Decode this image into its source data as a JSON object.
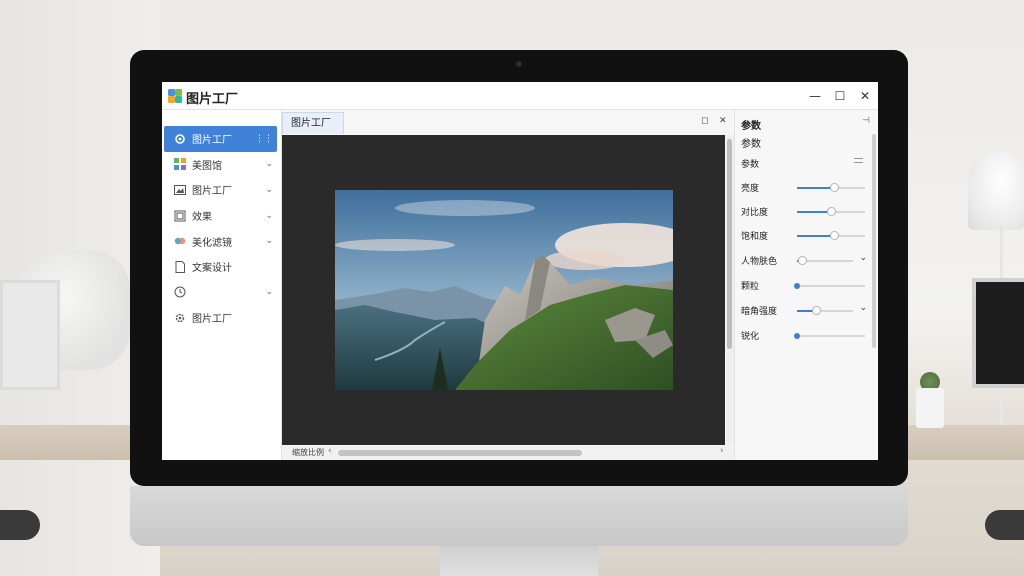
{
  "app": {
    "title": "图片工厂",
    "window_controls": {
      "minimize": "—",
      "maximize": "☐",
      "close": "✕"
    }
  },
  "sidebar": {
    "items": [
      {
        "label": "图片工厂",
        "icon": "gear-icon",
        "active": true
      },
      {
        "label": "美图馆",
        "icon": "grid-icon",
        "active": false
      },
      {
        "label": "图片工厂",
        "icon": "image-icon",
        "active": false
      },
      {
        "label": "效果",
        "icon": "frame-icon",
        "active": false
      },
      {
        "label": "美化滤镜",
        "icon": "filter-icon",
        "active": false
      },
      {
        "label": "文案设计",
        "icon": "document-icon",
        "active": false
      },
      {
        "label": "",
        "icon": "clock-icon",
        "active": false
      },
      {
        "label": "图片工厂",
        "icon": "settings-icon",
        "active": false
      }
    ]
  },
  "center": {
    "tab_label": "图片工厂",
    "tab_controls": {
      "restore": "◻",
      "close": "✕"
    },
    "zoom_label": "缩放比例",
    "scroll_left": "‹",
    "scroll_right": "›"
  },
  "panel": {
    "title": "参数",
    "subtitle": "参数",
    "group_label": "参数",
    "rows": [
      {
        "label": "亮度",
        "value": 0.55,
        "type": "slider"
      },
      {
        "label": "对比度",
        "value": 0.5,
        "type": "slider"
      },
      {
        "label": "饱和度",
        "value": 0.55,
        "type": "slider"
      },
      {
        "label": "人物肤色",
        "value": 0.1,
        "type": "slider-dropdown"
      },
      {
        "label": "颗粒",
        "value": 0.0,
        "type": "dot"
      },
      {
        "label": "暗角强度",
        "value": 0.35,
        "type": "slider-dropdown"
      },
      {
        "label": "锐化",
        "value": 0.0,
        "type": "dot"
      }
    ]
  },
  "colors": {
    "accent": "#3f82d8",
    "canvas_bg": "#2a2a2a",
    "sidebar_bg": "#ffffff"
  }
}
